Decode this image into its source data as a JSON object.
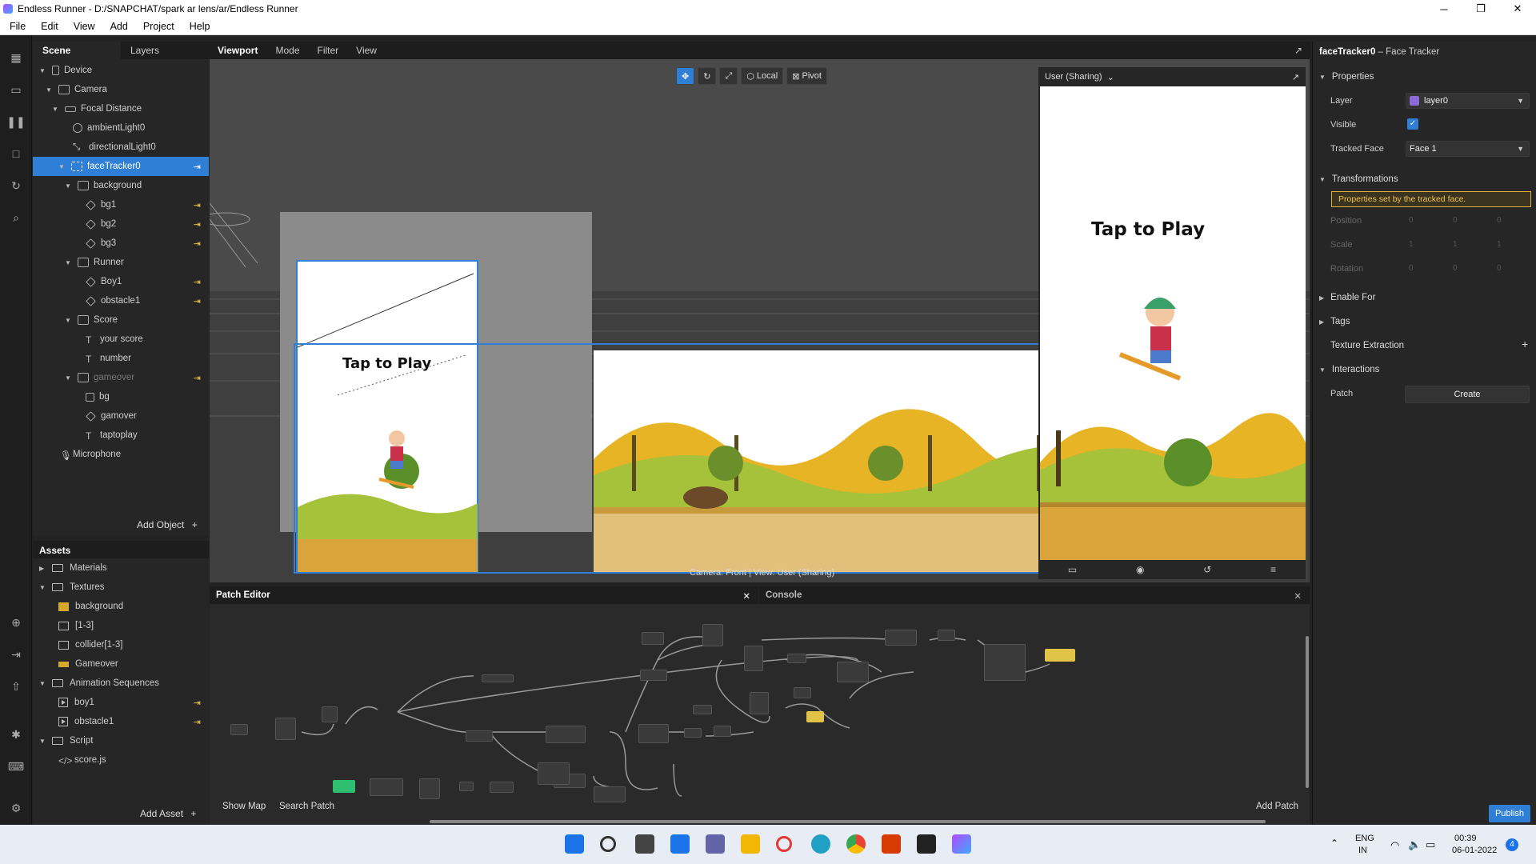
{
  "window": {
    "title": "Endless Runner - D:/SNAPCHAT/spark ar lens/ar/Endless Runner",
    "minimize": "─",
    "maximize": "❐",
    "close": "✕"
  },
  "menu": [
    "File",
    "Edit",
    "View",
    "Add",
    "Project",
    "Help"
  ],
  "scene": {
    "tabs": [
      "Scene",
      "Layers"
    ],
    "tree": [
      {
        "label": "Device"
      },
      {
        "label": "Camera"
      },
      {
        "label": "Focal Distance"
      },
      {
        "label": "ambientLight0"
      },
      {
        "label": "directionalLight0"
      },
      {
        "label": "faceTracker0"
      },
      {
        "label": "background"
      },
      {
        "label": "bg1"
      },
      {
        "label": "bg2"
      },
      {
        "label": "bg3"
      },
      {
        "label": "Runner"
      },
      {
        "label": "Boy1"
      },
      {
        "label": "obstacle1"
      },
      {
        "label": "Score"
      },
      {
        "label": "your score"
      },
      {
        "label": "number"
      },
      {
        "label": "gameover"
      },
      {
        "label": "bg"
      },
      {
        "label": "gamover"
      },
      {
        "label": "taptoplay"
      },
      {
        "label": "Microphone"
      }
    ],
    "add_object": "Add Object",
    "pin": "⇥",
    "plus": "+"
  },
  "assets": {
    "title": "Assets",
    "items": [
      {
        "label": "Materials"
      },
      {
        "label": "Textures"
      },
      {
        "label": "background"
      },
      {
        "label": "[1-3]"
      },
      {
        "label": "collider[1-3]"
      },
      {
        "label": "Gameover"
      },
      {
        "label": "Animation Sequences"
      },
      {
        "label": "boy1"
      },
      {
        "label": "obstacle1"
      },
      {
        "label": "Script"
      },
      {
        "label": "score.js"
      }
    ],
    "add_asset": "Add Asset"
  },
  "viewport": {
    "tabs": [
      "Viewport",
      "Mode",
      "Filter",
      "View"
    ],
    "local": "Local",
    "pivot": "Pivot",
    "camera_label": "Camera: Front | View: User (Sharing)",
    "tap_to_play": "Tap to Play"
  },
  "simulator": {
    "device": "User (Sharing)",
    "tap_to_play": "Tap to Play"
  },
  "inspector": {
    "title": "faceTracker0",
    "subtitle": "– Face Tracker",
    "properties": "Properties",
    "layer_label": "Layer",
    "layer_value": "layer0",
    "visible_label": "Visible",
    "tracked_face_label": "Tracked Face",
    "tracked_face_value": "Face 1",
    "transformations": "Transformations",
    "warning": "Properties set by the tracked face.",
    "position": "Position",
    "scale": "Scale",
    "rotation": "Rotation",
    "zero": "0",
    "one": "1",
    "enable_for": "Enable For",
    "tags": "Tags",
    "texture_extraction": "Texture Extraction",
    "interactions": "Interactions",
    "patch": "Patch",
    "create": "Create",
    "publish": "Publish"
  },
  "patch_editor": {
    "title": "Patch Editor",
    "console": "Console",
    "show_map": "Show Map",
    "search_patch": "Search Patch",
    "add_patch": "Add Patch",
    "close": "✕"
  },
  "taskbar": {
    "lang": "ENG",
    "region": "IN",
    "time": "00:39",
    "date": "06-01-2022",
    "notifications": "4"
  },
  "colors": {
    "accent": "#2f7fd6",
    "pin": "#f2c94c",
    "warning": "#f0c24a"
  }
}
